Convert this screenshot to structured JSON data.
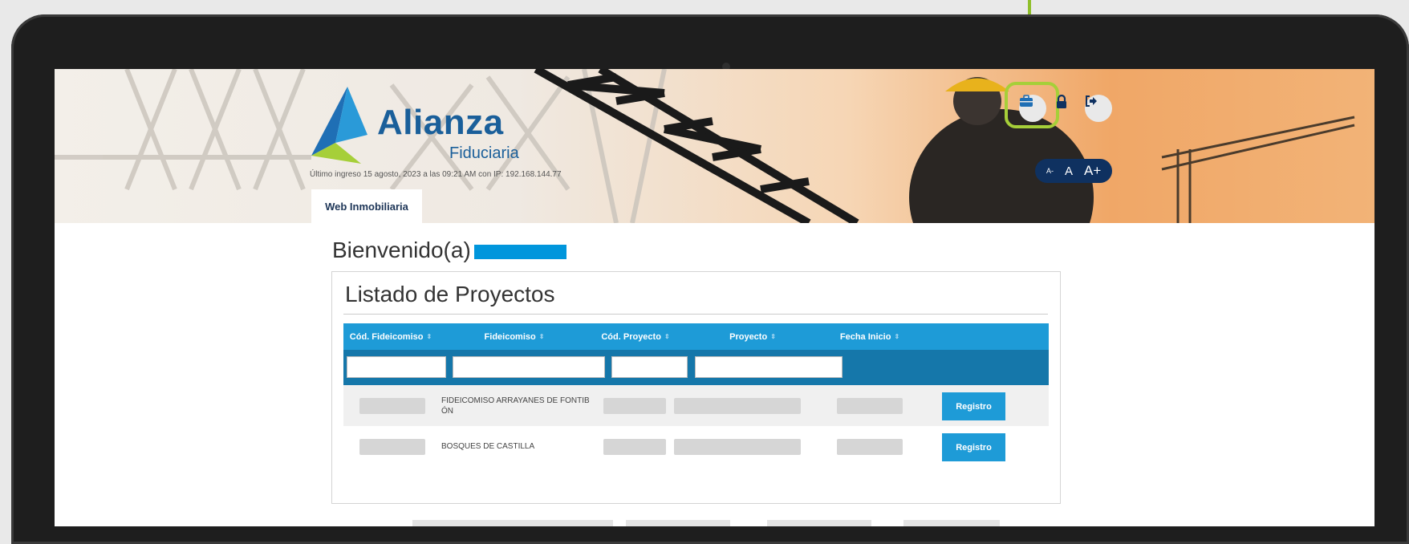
{
  "app": {
    "logo_name": "Alianza",
    "logo_sub": "Fiduciaria",
    "last_login": "Último ingreso 15 agosto, 2023 a las 09:21 AM con IP: 192.168.144.77"
  },
  "header": {
    "icons": [
      "briefcase-icon",
      "lock-icon",
      "logout-icon"
    ],
    "font_controls": {
      "smaller": "A-",
      "normal": "A",
      "bigger": "A+"
    },
    "highlight_color": "#a6cf39"
  },
  "tabs": [
    {
      "label": "Web Inmobiliaria",
      "active": true
    }
  ],
  "welcome": "Bienvenido(a)",
  "projects": {
    "title": "Listado de Proyectos",
    "columns": [
      "Cód. Fideicomiso",
      "Fideicomiso",
      "Cód. Proyecto",
      "Proyecto",
      "Fecha Inicio"
    ],
    "rows": [
      {
        "fideicomiso": "FIDEICOMISO ARRAYANES DE FONTIB ÓN",
        "action": "Registro"
      },
      {
        "fideicomiso": "BOSQUES DE CASTILLA",
        "action": "Registro"
      }
    ]
  },
  "colors": {
    "accent": "#1e9bd7",
    "filter_bar": "#1577aa",
    "brand": "#1a5f9a",
    "font_pill": "#0f3160"
  }
}
